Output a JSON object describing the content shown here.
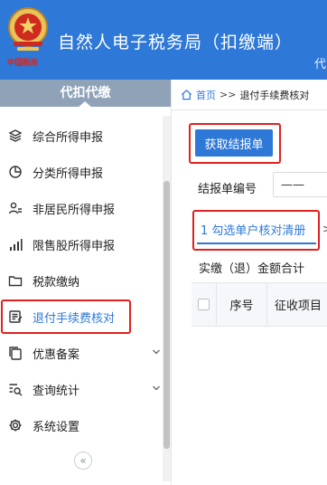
{
  "header": {
    "title": "自然人电子税务局（扣缴端）",
    "logo_caption": "中国税务",
    "right_text": "代"
  },
  "sidebar": {
    "heading": "代扣代缴",
    "items": [
      {
        "label": "综合所得申报",
        "icon": "layers-icon"
      },
      {
        "label": "分类所得申报",
        "icon": "pie-chart-icon"
      },
      {
        "label": "非居民所得申报",
        "icon": "user-list-icon"
      },
      {
        "label": "限售股所得申报",
        "icon": "bar-chart-icon"
      },
      {
        "label": "税款缴纳",
        "icon": "folder-icon"
      },
      {
        "label": "退付手续费核对",
        "icon": "edit-doc-icon",
        "active": true
      },
      {
        "label": "优惠备案",
        "icon": "copy-icon",
        "expandable": true
      },
      {
        "label": "查询统计",
        "icon": "search-list-icon",
        "expandable": true
      },
      {
        "label": "系统设置",
        "icon": "gear-icon"
      }
    ],
    "collapse_symbol": "«"
  },
  "breadcrumb": {
    "home": "首页",
    "separator": ">>",
    "current": "退付手续费核对"
  },
  "main": {
    "get_statement_button": "获取结报单",
    "statement_no_label": "结报单编号",
    "statement_no_value": "——",
    "tab_label": "1 勾选单户核对清册",
    "tab_next_arrow": ">",
    "total_label": "实缴（退）金额合计",
    "table_headers": {
      "seq": "序号",
      "item": "征收项目"
    }
  },
  "colors": {
    "brand_blue": "#2e78d8",
    "highlight_red": "#e02020",
    "sidebar_head": "#8fa2b8"
  }
}
